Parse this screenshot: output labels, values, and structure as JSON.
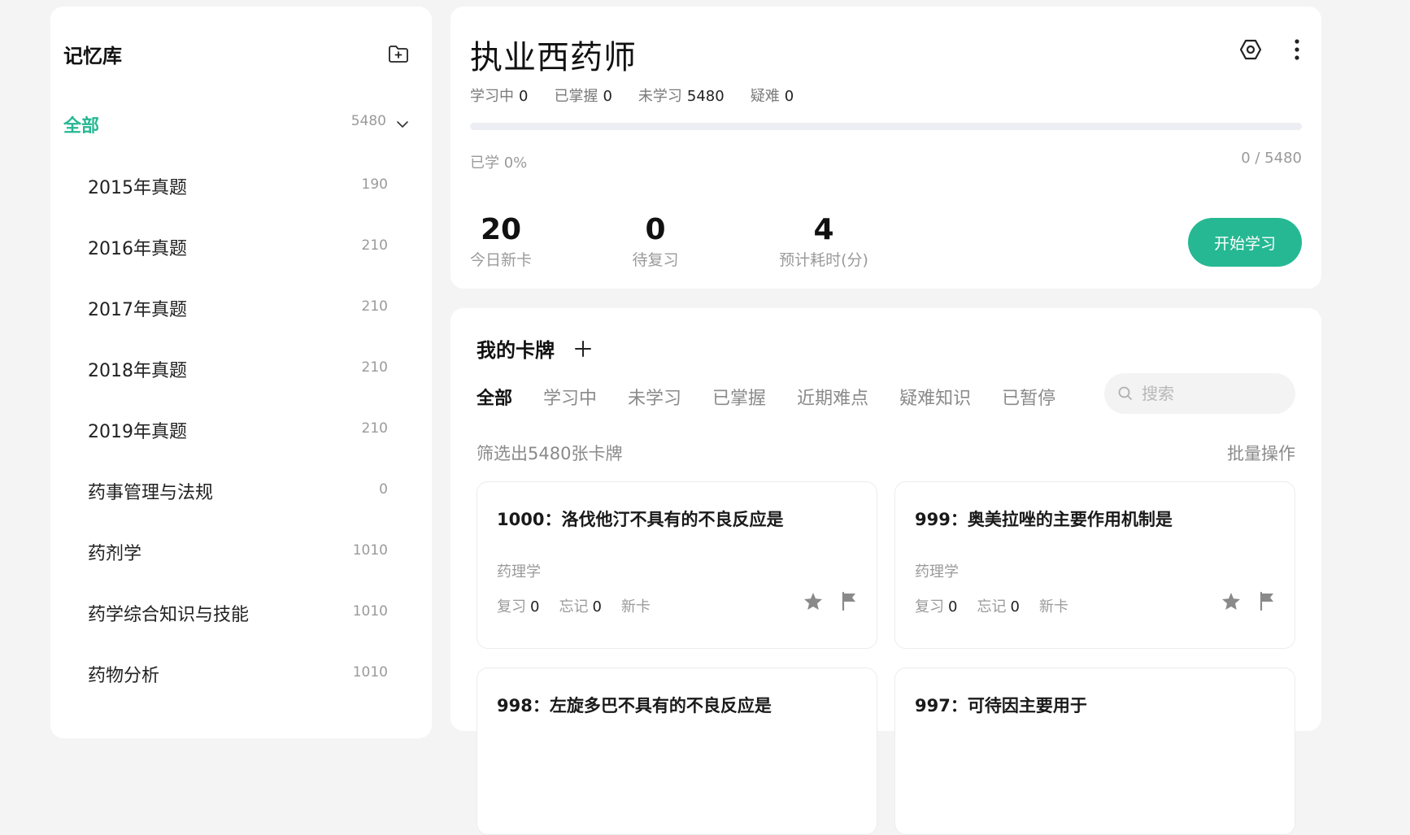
{
  "sidebar": {
    "title": "记忆库",
    "all": {
      "label": "全部",
      "count": "5480"
    },
    "decks": [
      {
        "name": "2015年真题",
        "count": "190"
      },
      {
        "name": "2016年真题",
        "count": "210"
      },
      {
        "name": "2017年真题",
        "count": "210"
      },
      {
        "name": "2018年真题",
        "count": "210"
      },
      {
        "name": "2019年真题",
        "count": "210"
      },
      {
        "name": "药事管理与法规",
        "count": "0"
      },
      {
        "name": "药剂学",
        "count": "1010"
      },
      {
        "name": "药学综合知识与技能",
        "count": "1010"
      },
      {
        "name": "药物分析",
        "count": "1010"
      }
    ]
  },
  "deck": {
    "title": "执业西药师",
    "status": [
      {
        "label": "学习中",
        "value": "0"
      },
      {
        "label": "已掌握",
        "value": "0"
      },
      {
        "label": "未学习",
        "value": "5480"
      },
      {
        "label": "疑难",
        "value": "0"
      }
    ],
    "progress": {
      "percent": 0,
      "left_label": "已学 0%",
      "right_label": "0 / 5480"
    },
    "metrics": [
      {
        "value": "20",
        "label": "今日新卡"
      },
      {
        "value": "0",
        "label": "待复习"
      },
      {
        "value": "4",
        "label": "预计耗时(分)"
      }
    ],
    "start_label": "开始学习"
  },
  "cards_section": {
    "title": "我的卡牌",
    "tabs": [
      "全部",
      "学习中",
      "未学习",
      "已掌握",
      "近期难点",
      "疑难知识",
      "已暂停"
    ],
    "search_placeholder": "搜索",
    "filter_summary": "筛选出5480张卡牌",
    "batch_label": "批量操作",
    "cards": [
      {
        "title": "1000：洛伐他汀不具有的不良反应是",
        "tag": "药理学",
        "review_label": "复习",
        "review": "0",
        "forget_label": "忘记",
        "forget": "0",
        "state": "新卡"
      },
      {
        "title": "999：奥美拉唑的主要作用机制是",
        "tag": "药理学",
        "review_label": "复习",
        "review": "0",
        "forget_label": "忘记",
        "forget": "0",
        "state": "新卡"
      },
      {
        "title": "998：左旋多巴不具有的不良反应是",
        "tag": "",
        "review_label": "",
        "review": "",
        "forget_label": "",
        "forget": "",
        "state": ""
      },
      {
        "title": "997：可待因主要用于",
        "tag": "",
        "review_label": "",
        "review": "",
        "forget_label": "",
        "forget": "",
        "state": ""
      }
    ]
  },
  "colors": {
    "accent": "#25b893",
    "background": "#f4f4f5",
    "panel": "#ffffff",
    "muted": "#9a9a9a"
  },
  "icons": [
    "add-folder-icon",
    "chevron-down-icon",
    "settings-hex-icon",
    "more-vertical-icon",
    "plus-icon",
    "search-icon",
    "star-icon",
    "flag-icon"
  ]
}
